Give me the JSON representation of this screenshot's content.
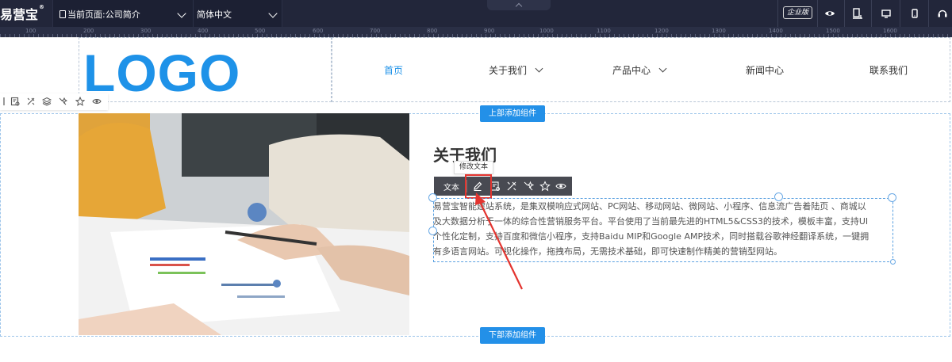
{
  "topbar": {
    "brand": "易营宝",
    "brand_mark": "®",
    "current_page": "当前页面:公司简介",
    "language": "简体中文",
    "edition": "企业版",
    "icons": [
      "eye-icon",
      "device-responsive-icon",
      "desktop-icon",
      "mobile-icon",
      "support-icon"
    ]
  },
  "ruler": {
    "labels": [
      "100",
      "200",
      "300",
      "400",
      "500",
      "600",
      "700",
      "800",
      "900",
      "1000",
      "1100",
      "1200",
      "1300",
      "1400",
      "1500",
      "1600"
    ]
  },
  "header": {
    "logo": "LOGO",
    "nav": [
      {
        "label": "首页",
        "active": true
      },
      {
        "label": "关于我们",
        "dropdown": true
      },
      {
        "label": "产品中心",
        "dropdown": true
      },
      {
        "label": "新闻中心"
      },
      {
        "label": "联系我们"
      }
    ]
  },
  "left_tools": {
    "icons": [
      "settings-icon",
      "tool-icon",
      "layers-icon",
      "animation-icon",
      "star-icon",
      "eye-icon"
    ]
  },
  "section": {
    "add_top": "上部添加组件",
    "add_bottom": "下部添加组件",
    "title": "关于我们",
    "tooltip": "修改文本",
    "toolbar_label": "文本",
    "toolbar_icons": [
      "edit-icon",
      "settings-icon",
      "tool-icon",
      "animation-icon",
      "star-icon",
      "eye-icon"
    ],
    "body_lines": [
      "易营宝智能建站系统，是集双模响应式网站、PC网站、移动网站、微网站、小程序、信息流广告着陆页 、商城以",
      "及大数据分析于一体的综合性营销服务平台。平台使用了当前最先进的HTML5&CSS3的技术，模板丰富，支持UI",
      "个性化定制，支持百度和微信小程序，支持Baidu MIP和Google AMP技术，同时搭载谷歌神经翻译系统，一键拥",
      "有多语言网站。可视化操作，拖拽布局，无需技术基础，即可快速制作精美的营销型网站。"
    ]
  },
  "colors": {
    "topbar_bg": "#22263a",
    "accent": "#1e92e8",
    "annotation_red": "#e3342f",
    "element_toolbar_bg": "#484a52"
  }
}
